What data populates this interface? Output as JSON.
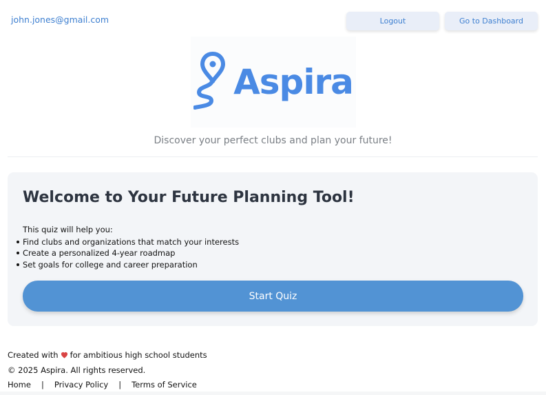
{
  "header": {
    "user_email": "john.jones@gmail.com",
    "logout_label": "Logout",
    "dashboard_label": "Go to Dashboard"
  },
  "brand": {
    "name": "Aspira",
    "color": "#4a8ae4",
    "icon": "map-pin-route-icon"
  },
  "tagline": "Discover your perfect clubs and plan your future!",
  "card": {
    "title": "Welcome to Your Future Planning Tool!",
    "intro": "This quiz will help you:",
    "items": [
      "Find clubs and organizations that match your interests",
      "Create a personalized 4-year roadmap",
      "Set goals for college and career preparation"
    ],
    "start_label": "Start Quiz"
  },
  "footer": {
    "created_prefix": "Created with",
    "created_suffix": "for ambitious high school students",
    "heart_icon": "heart-icon",
    "copyright": "© 2025 Aspira. All rights reserved.",
    "links": [
      "Home",
      "Privacy Policy",
      "Terms of Service"
    ],
    "separator": "|"
  },
  "colors": {
    "accent": "#5293d4",
    "link": "#3d7fd0",
    "heading": "#2d3440",
    "card_bg": "#f3f5f8"
  }
}
